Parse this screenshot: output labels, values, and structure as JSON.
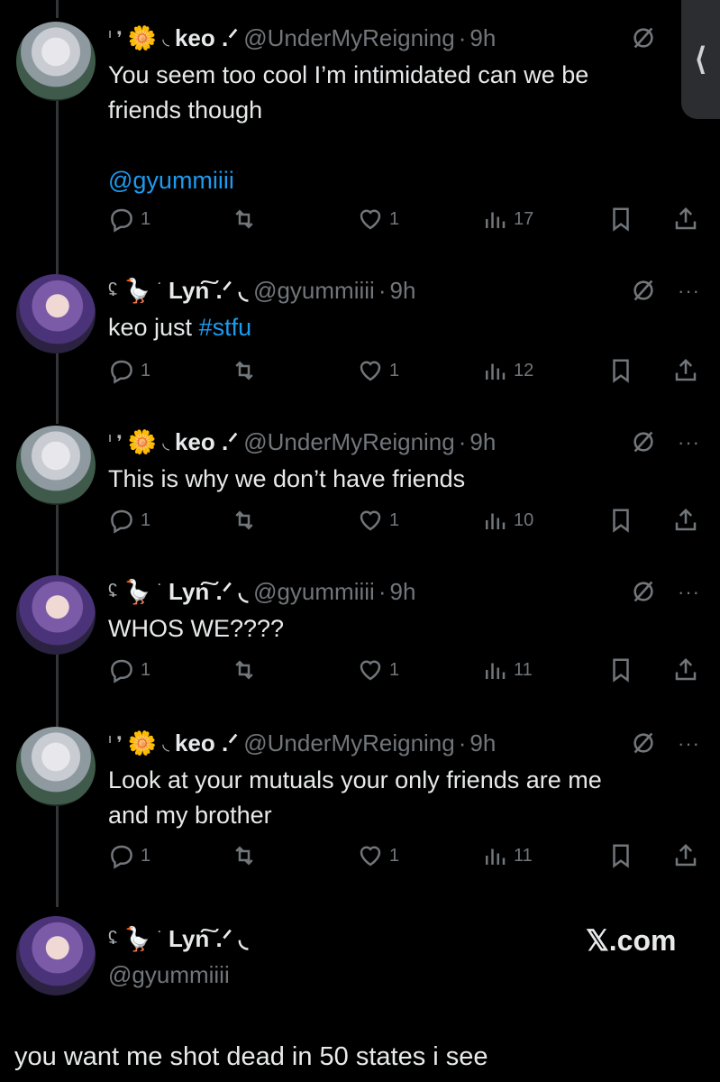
{
  "side_tab": {
    "glyph": "⟨"
  },
  "tweets": [
    {
      "account": "keo",
      "deco_left": "ᑊ ❜",
      "emoji": "🌼",
      "deco_right": "◟",
      "name": "keo .ᐟ",
      "handle": "@UnderMyReigning",
      "time": "9h",
      "text_lines": [
        "You seem too cool I’m intimidated can we be",
        "friends though"
      ],
      "mention": "@gyummiiii",
      "replies": "1",
      "likes": "1",
      "views": "17"
    },
    {
      "account": "lyn",
      "deco_left": "ʢ",
      "emoji": "🪿",
      "deco_right": "˙",
      "name": "Lyn͠ .ᐟ ◟",
      "handle": "@gyummiiii",
      "time": "9h",
      "text": "keo just ",
      "hashtag": "#stfu",
      "replies": "1",
      "likes": "1",
      "views": "12"
    },
    {
      "account": "keo",
      "deco_left": "ᑊ ❜",
      "emoji": "🌼",
      "deco_right": "◟",
      "name": "keo .ᐟ",
      "handle": "@UnderMyReigning",
      "time": "9h",
      "text": "This is why we don’t have friends",
      "replies": "1",
      "likes": "1",
      "views": "10"
    },
    {
      "account": "lyn",
      "deco_left": "ʢ",
      "emoji": "🪿",
      "deco_right": "˙",
      "name": "Lyn͠ .ᐟ ◟",
      "handle": "@gyummiiii",
      "time": "9h",
      "text": "WHOS WE????",
      "replies": "1",
      "likes": "1",
      "views": "11"
    },
    {
      "account": "keo",
      "deco_left": "ᑊ ❜",
      "emoji": "🌼",
      "deco_right": "◟",
      "name": "keo .ᐟ",
      "handle": "@UnderMyReigning",
      "time": "9h",
      "text_lines": [
        "Look at your mutuals your only friends are me",
        "and my brother"
      ],
      "replies": "1",
      "likes": "1",
      "views": "11"
    }
  ],
  "final": {
    "deco_left": "ʢ",
    "emoji": "🪿",
    "deco_right": "˙",
    "name": "Lyn͠ .ᐟ ◟",
    "handle": "@gyummiiii",
    "watermark": "𝕏.com",
    "text": "you want me shot dead in 50 states i see"
  },
  "icons": [
    "reply-icon",
    "retweet-icon",
    "like-icon",
    "views-icon",
    "bookmark-icon",
    "share-icon",
    "grok-icon",
    "more-icon"
  ],
  "colors": {
    "background": "#000000",
    "text": "#e7e9ea",
    "muted": "#71767b",
    "link": "#1d9bf0"
  }
}
